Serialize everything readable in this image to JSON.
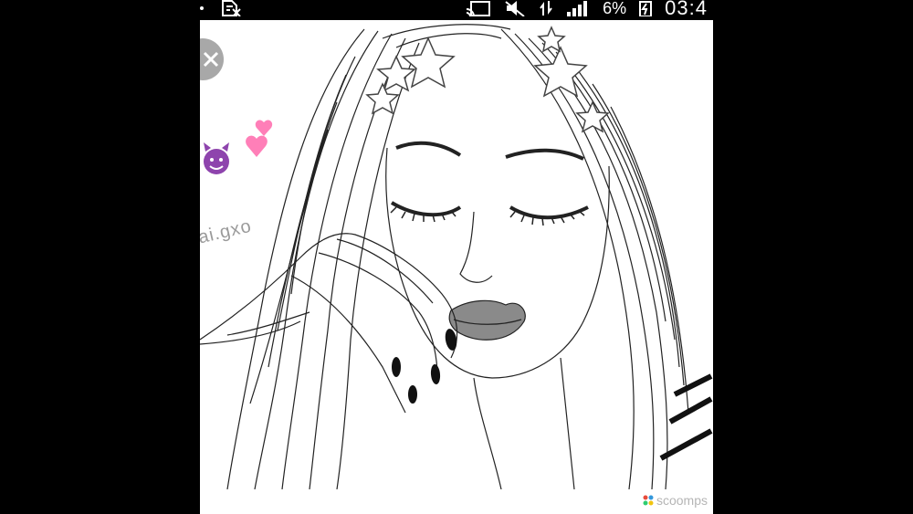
{
  "status_bar": {
    "battery_percent": "6%",
    "time": "03:4"
  },
  "image": {
    "watermark_text": "ai.gxo",
    "close_icon": "close-icon",
    "emojis": [
      "smiling-devil-emoji",
      "two-hearts-emoji"
    ]
  },
  "footer": {
    "brand_text": "scoomps"
  },
  "colors": {
    "background": "#000000",
    "panel": "#ffffff",
    "devil": "#8e44ad",
    "hearts": "#ff7fb8"
  }
}
